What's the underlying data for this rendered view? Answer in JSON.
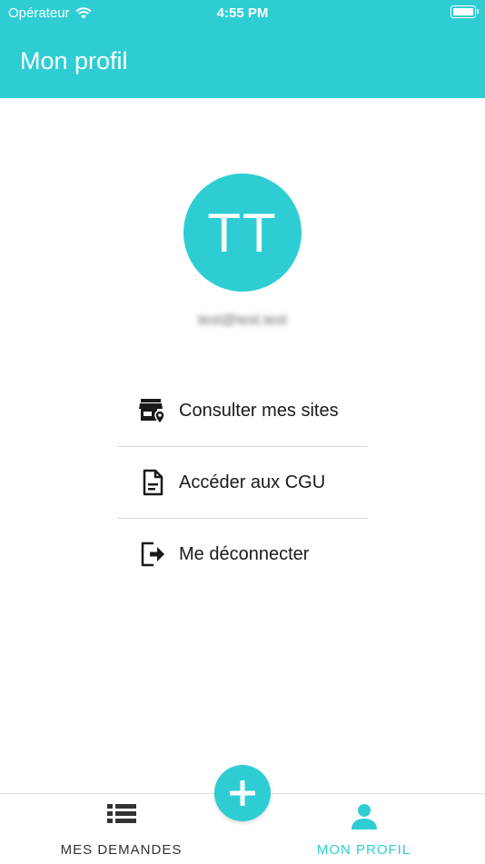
{
  "status_bar": {
    "carrier": "Opérateur",
    "time": "4:55 PM"
  },
  "header": {
    "title": "Mon profil"
  },
  "profile": {
    "initials": "TT",
    "email": "test@test.test"
  },
  "menu": {
    "items": [
      {
        "label": "Consulter mes sites",
        "icon": "store-location-icon"
      },
      {
        "label": "Accéder aux CGU",
        "icon": "document-icon"
      },
      {
        "label": "Me déconnecter",
        "icon": "logout-icon"
      }
    ]
  },
  "tabs": [
    {
      "label": "MES DEMANDES",
      "icon": "list-icon"
    },
    {
      "label": "MON PROFIL",
      "icon": "user-icon"
    }
  ],
  "colors": {
    "accent": "#2ecdd4",
    "text": "#1a1a1a",
    "divider": "#d8d8d8"
  }
}
